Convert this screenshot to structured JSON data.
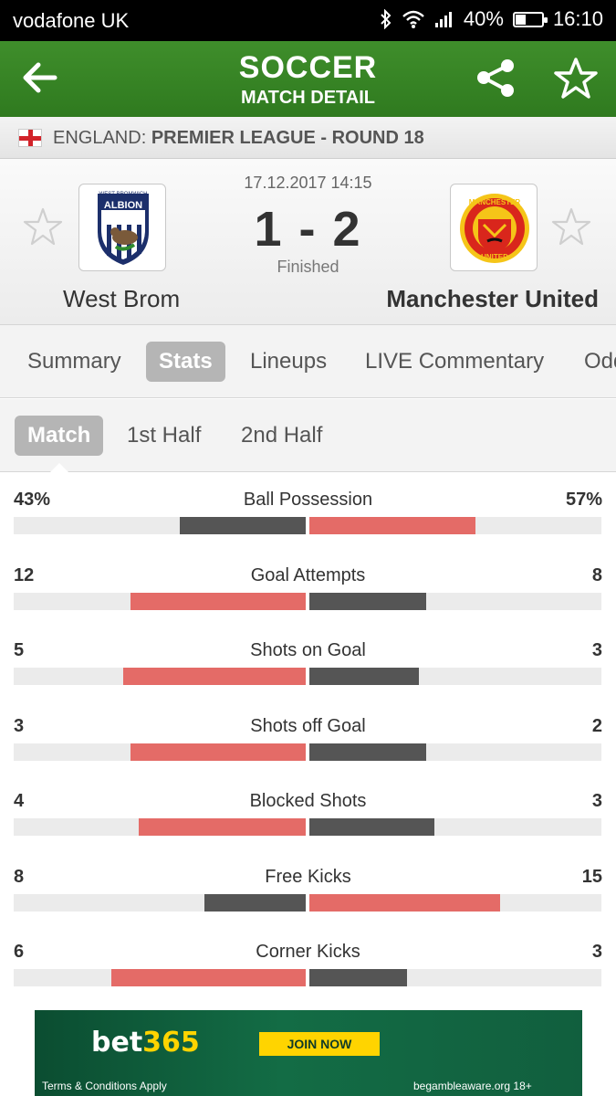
{
  "status_bar": {
    "carrier": "vodafone UK",
    "battery": "40%",
    "battery_level": 0.4,
    "time": "16:10"
  },
  "header": {
    "title": "SOCCER",
    "subtitle": "MATCH DETAIL"
  },
  "league": {
    "country": "ENGLAND:",
    "competition": "PREMIER LEAGUE - ROUND 18"
  },
  "match": {
    "datetime": "17.12.2017 14:15",
    "score": "1 - 2",
    "status": "Finished",
    "home": {
      "name": "West Brom",
      "crest_text": [
        "WEST BROMWICH",
        "ALBION"
      ]
    },
    "away": {
      "name": "Manchester United",
      "crest_text": [
        "MANCHESTER",
        "UNITED"
      ]
    }
  },
  "tabs": [
    "Summary",
    "Stats",
    "Lineups",
    "LIVE Commentary",
    "Odds"
  ],
  "active_tab": "Stats",
  "subtabs": [
    "Match",
    "1st Half",
    "2nd Half"
  ],
  "active_subtab": "Match",
  "colors": {
    "header_green": "#3a8a28",
    "bar_red": "#e46b67",
    "bar_dark": "#555555"
  },
  "stats": [
    {
      "label": "Ball Possession",
      "home": "43%",
      "away": "57%",
      "home_value": 43,
      "away_value": 57,
      "leader": "away"
    },
    {
      "label": "Goal Attempts",
      "home": "12",
      "away": "8",
      "home_value": 12,
      "away_value": 8,
      "leader": "home"
    },
    {
      "label": "Shots on Goal",
      "home": "5",
      "away": "3",
      "home_value": 5,
      "away_value": 3,
      "leader": "home"
    },
    {
      "label": "Shots off Goal",
      "home": "3",
      "away": "2",
      "home_value": 3,
      "away_value": 2,
      "leader": "home"
    },
    {
      "label": "Blocked Shots",
      "home": "4",
      "away": "3",
      "home_value": 4,
      "away_value": 3,
      "leader": "home"
    },
    {
      "label": "Free Kicks",
      "home": "8",
      "away": "15",
      "home_value": 8,
      "away_value": 15,
      "leader": "away"
    },
    {
      "label": "Corner Kicks",
      "home": "6",
      "away": "3",
      "home_value": 6,
      "away_value": 3,
      "leader": "home"
    }
  ],
  "ad": {
    "brand_a": "bet",
    "brand_b": "365",
    "cta": "JOIN NOW",
    "terms": "Terms & Conditions Apply",
    "aware": "begambleaware.org 18+"
  }
}
